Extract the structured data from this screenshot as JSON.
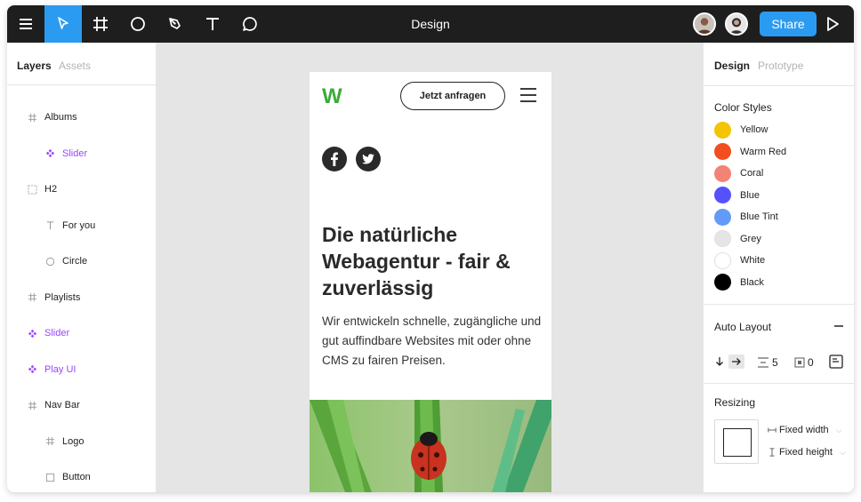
{
  "toolbar": {
    "title": "Design",
    "share_label": "Share",
    "tools": [
      "menu-icon",
      "move-pointer-icon",
      "frame-hash-icon",
      "ellipse-icon",
      "pen-icon",
      "text-icon",
      "comment-icon"
    ]
  },
  "left_panel": {
    "tabs": [
      "Layers",
      "Assets"
    ],
    "layers": [
      {
        "label": "Albums",
        "icon": "frame-hash-icon",
        "indent": 0
      },
      {
        "label": "Slider",
        "icon": "component-icon",
        "indent": 1,
        "purple": true
      },
      {
        "label": "H2",
        "icon": "dashed-frame-icon",
        "indent": 0
      },
      {
        "label": "For you",
        "icon": "text-icon",
        "indent": 1
      },
      {
        "label": "Circle",
        "icon": "ellipse-icon",
        "indent": 1
      },
      {
        "label": "Playlists",
        "icon": "frame-hash-icon",
        "indent": 0
      },
      {
        "label": "Slider",
        "icon": "component-icon",
        "indent": 0,
        "purple": true
      },
      {
        "label": "Play UI",
        "icon": "component-icon",
        "indent": 0,
        "purple": true
      },
      {
        "label": "Nav Bar",
        "icon": "frame-hash-icon",
        "indent": 0
      },
      {
        "label": "Logo",
        "icon": "frame-hash-icon",
        "indent": 1
      },
      {
        "label": "Button",
        "icon": "rectangle-icon",
        "indent": 1
      }
    ]
  },
  "canvas": {
    "logo": "W",
    "cta_label": "Jetzt anfragen",
    "headline": "Die natürliche Webagentur - fair & zuverlässig",
    "body": "Wir entwickeln schnelle, zugängliche und gut auffindbare Websites mit oder ohne CMS zu fairen Preisen."
  },
  "right_panel": {
    "tabs": [
      "Design",
      "Prototype"
    ],
    "color_styles_title": "Color Styles",
    "colors": [
      {
        "name": "Yellow",
        "hex": "#f5c400"
      },
      {
        "name": "Warm Red",
        "hex": "#f24e1e"
      },
      {
        "name": "Coral",
        "hex": "#f38374"
      },
      {
        "name": "Blue",
        "hex": "#5551ff"
      },
      {
        "name": "Blue Tint",
        "hex": "#629bf7"
      },
      {
        "name": "Grey",
        "hex": "#e5e5e5"
      },
      {
        "name": "White",
        "hex": "#ffffff"
      },
      {
        "name": "Black",
        "hex": "#000000"
      }
    ],
    "auto_layout_title": "Auto Layout",
    "auto_layout_spacing": "5",
    "auto_layout_padding": "0",
    "resizing_title": "Resizing",
    "fixed_width_label": "Fixed width",
    "fixed_height_label": "Fixed height"
  }
}
